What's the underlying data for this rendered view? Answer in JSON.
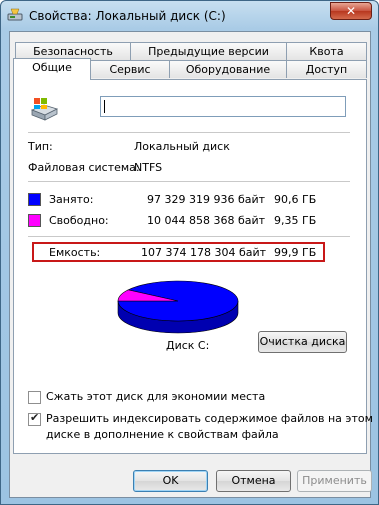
{
  "window": {
    "title": "Свойства: Локальный диск (C:)",
    "close_symbol": "✕"
  },
  "tabs": {
    "row1": [
      "Безопасность",
      "Предыдущие версии",
      "Квота"
    ],
    "row2": [
      "Общие",
      "Сервис",
      "Оборудование",
      "Доступ"
    ],
    "active": "Общие"
  },
  "general": {
    "drive_name": "",
    "type_label": "Тип:",
    "type_value": "Локальный диск",
    "fs_label": "Файловая система:",
    "fs_value": "NTFS"
  },
  "space": {
    "used": {
      "label": "Занято:",
      "bytes": "97 329 319 936 байт",
      "size": "90,6 ГБ"
    },
    "free": {
      "label": "Свободно:",
      "bytes": "10 044 858 368 байт",
      "size": "9,35 ГБ"
    },
    "capacity": {
      "label": "Емкость:",
      "bytes": "107 374 178 304 байт",
      "size": "99,9 ГБ"
    }
  },
  "colors": {
    "used": "#0000ff",
    "free": "#ff00ff",
    "highlight": "#c81818"
  },
  "pie": {
    "used_fraction": 0.906,
    "free_fraction": 0.094
  },
  "disk_label": "Диск C:",
  "cleanup_button": "Очистка диска",
  "options": {
    "compress": {
      "label": "Сжать этот диск для экономии места",
      "checked": false
    },
    "index": {
      "line1": "Разрешить индексировать содержимое файлов на этом",
      "line2": "диске в дополнение к свойствам файла",
      "checked": true
    }
  },
  "buttons": {
    "ok": "OK",
    "cancel": "Отмена",
    "apply": "Применить"
  },
  "icons": {
    "title": "drive-icon",
    "drive": "hard-drive-icon",
    "close": "close-icon"
  }
}
